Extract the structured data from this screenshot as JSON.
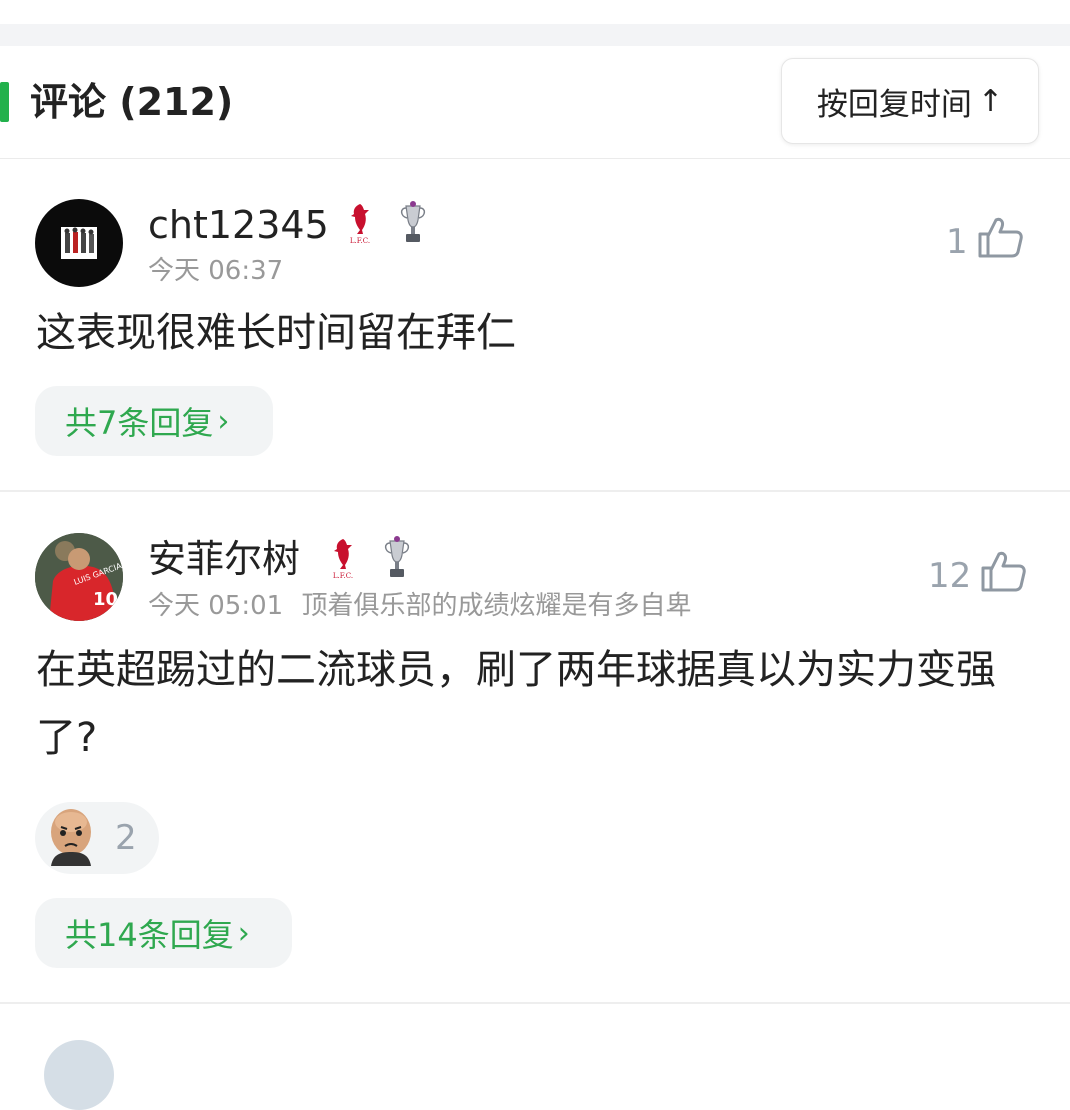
{
  "header": {
    "title": "评论 (212)",
    "sort_label": "按回复时间",
    "sort_arrow": "↑"
  },
  "comments": [
    {
      "username": "cht12345",
      "time": "今天 06:37",
      "signature": "",
      "likes": "1",
      "content": "这表现很难长时间留在拜仁",
      "replies_label": "共7条回复",
      "badges": [
        "lfc-liver-bird-icon",
        "premier-league-trophy-icon"
      ]
    },
    {
      "username": "安菲尔树",
      "time": "今天 05:01",
      "signature": "顶着俱乐部的成绩炫耀是有多自卑",
      "likes": "12",
      "content": "在英超踢过的二流球员，刷了两年球据真以为实力变强了?",
      "reaction_count": "2",
      "replies_label": "共14条回复",
      "badges": [
        "lfc-liver-bird-icon",
        "premier-league-trophy-icon"
      ]
    }
  ],
  "colors": {
    "accent_green": "#22b14c",
    "reply_green": "#2fa84f",
    "muted": "#999999"
  }
}
